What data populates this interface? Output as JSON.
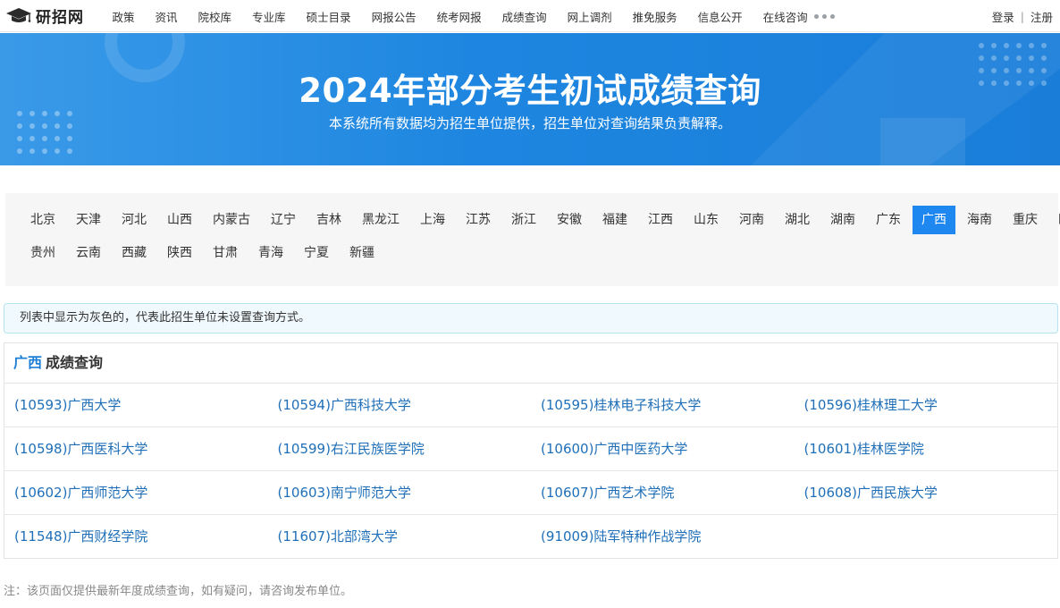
{
  "header": {
    "logo_text": "研招网",
    "nav": [
      "政策",
      "资讯",
      "院校库",
      "专业库",
      "硕士目录",
      "网报公告",
      "统考网报",
      "成绩查询",
      "网上调剂",
      "推免服务",
      "信息公开",
      "在线咨询"
    ],
    "more_icon": "more-dots-icon",
    "login": "登录",
    "separator": "|",
    "register": "注册"
  },
  "banner": {
    "title": "2024年部分考生初试成绩查询",
    "subtitle": "本系统所有数据均为招生单位提供，招生单位对查询结果负责解释。"
  },
  "provinces": {
    "row1": [
      "北京",
      "天津",
      "河北",
      "山西",
      "内蒙古",
      "辽宁",
      "吉林",
      "黑龙江",
      "上海",
      "江苏",
      "浙江",
      "安徽",
      "福建",
      "江西",
      "山东",
      "河南",
      "湖北",
      "湖南",
      "广东",
      "广西",
      "海南",
      "重庆",
      "四川"
    ],
    "row2": [
      "贵州",
      "云南",
      "西藏",
      "陕西",
      "甘肃",
      "青海",
      "宁夏",
      "新疆"
    ],
    "selected": "广西"
  },
  "notice": "列表中显示为灰色的，代表此招生单位未设置查询方式。",
  "results": {
    "province": "广西",
    "heading": "成绩查询",
    "rows": [
      [
        "(10593)广西大学",
        "(10594)广西科技大学",
        "(10595)桂林电子科技大学",
        "(10596)桂林理工大学"
      ],
      [
        "(10598)广西医科大学",
        "(10599)右江民族医学院",
        "(10600)广西中医药大学",
        "(10601)桂林医学院"
      ],
      [
        "(10602)广西师范大学",
        "(10603)南宁师范大学",
        "(10607)广西艺术学院",
        "(10608)广西民族大学"
      ],
      [
        "(11548)广西财经学院",
        "(11607)北部湾大学",
        "(91009)陆军特种作战学院",
        ""
      ]
    ]
  },
  "footnote": "注：该页面仅提供最新年度成绩查询，如有疑问，请咨询发布单位。",
  "colors": {
    "banner_blue": "#1e86e0",
    "active_blue": "#1e87f0",
    "link_blue": "#1f6fb8"
  }
}
